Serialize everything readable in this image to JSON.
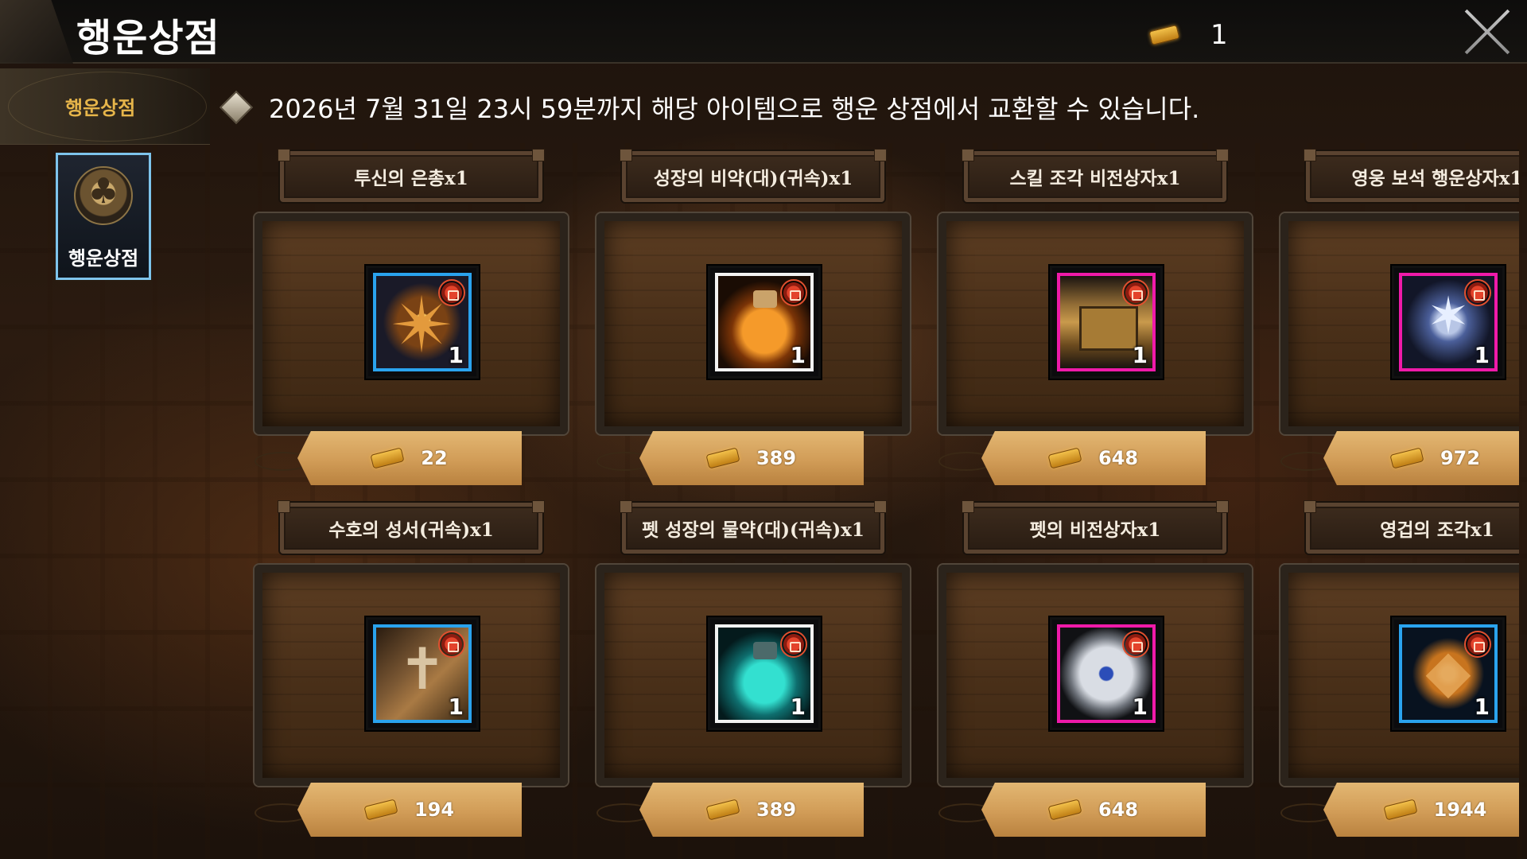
{
  "header": {
    "title": "행운상점",
    "currency_icon": "ticket-icon",
    "currency_count": "1",
    "close_icon": "close-icon"
  },
  "sidebar": {
    "tab_label": "행운상점",
    "categories": [
      {
        "label": "행운상점",
        "icon": "clover-icon",
        "selected": true
      }
    ]
  },
  "notice": {
    "icon": "diamond-icon",
    "text": "2026년 7월 31일 23시 59분까지 해당 아이템으로 행운 상점에서 교환할 수 있습니다."
  },
  "items": [
    {
      "name": "투신의 은총x1",
      "qty": "1",
      "price": "22",
      "rarity_color": "#2aa3ee",
      "locked": true
    },
    {
      "name": "성장의 비약(대)(귀속)x1",
      "qty": "1",
      "price": "389",
      "rarity_color": "#f2f2f2",
      "locked": true
    },
    {
      "name": "스킬 조각 비전상자x1",
      "qty": "1",
      "price": "648",
      "rarity_color": "#ef1aa9",
      "locked": true
    },
    {
      "name": "영웅 보석 행운상자x1",
      "qty": "1",
      "price": "972",
      "rarity_color": "#ef1aa9",
      "locked": true
    },
    {
      "name": "수호의 성서(귀속)x1",
      "qty": "1",
      "price": "194",
      "rarity_color": "#2aa3ee",
      "locked": true
    },
    {
      "name": "펫 성장의 물약(대)(귀속)x1",
      "qty": "1",
      "price": "389",
      "rarity_color": "#f2f2f2",
      "locked": true
    },
    {
      "name": "펫의 비전상자x1",
      "qty": "1",
      "price": "648",
      "rarity_color": "#ef1aa9",
      "locked": true
    },
    {
      "name": "영겁의 조각x1",
      "qty": "1",
      "price": "1944",
      "rarity_color": "#2aa3ee",
      "locked": true
    }
  ]
}
